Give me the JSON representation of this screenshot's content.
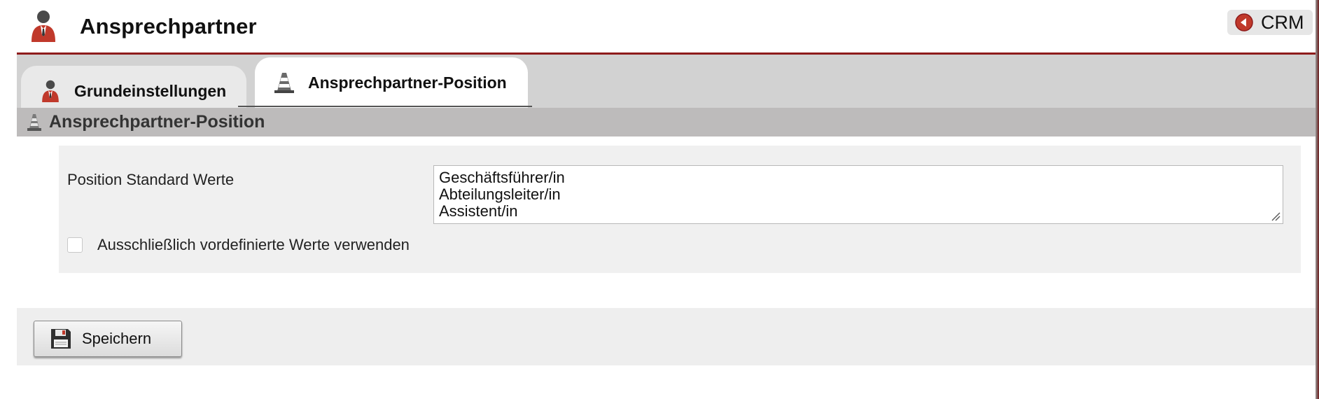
{
  "header": {
    "title": "Ansprechpartner",
    "icon": "contact-person-icon",
    "crm_button": {
      "label": "CRM",
      "icon": "crm-back-icon"
    }
  },
  "tabs": [
    {
      "label": "Grundeinstellungen",
      "icon": "contact-person-icon",
      "active": false
    },
    {
      "label": "Ansprechpartner-Position",
      "icon": "traffic-cone-icon",
      "active": true
    }
  ],
  "section": {
    "title": "Ansprechpartner-Position",
    "icon": "traffic-cone-icon"
  },
  "form": {
    "position_defaults_label": "Position Standard Werte",
    "position_defaults_lines": [
      "Geschäftsführer/in",
      "Abteilungsleiter/in",
      "Assistent/in"
    ],
    "predefined_only_label": "Ausschließlich vordefinierte Werte verwenden",
    "predefined_only_checked": false
  },
  "footer": {
    "save_label": "Speichern",
    "save_icon": "floppy-disk-icon"
  },
  "colors": {
    "accent_red": "#8e1b1b",
    "tab_strip": "#d2d2d2",
    "section_bar": "#bdbbbb",
    "panel": "#f0f0f0"
  }
}
